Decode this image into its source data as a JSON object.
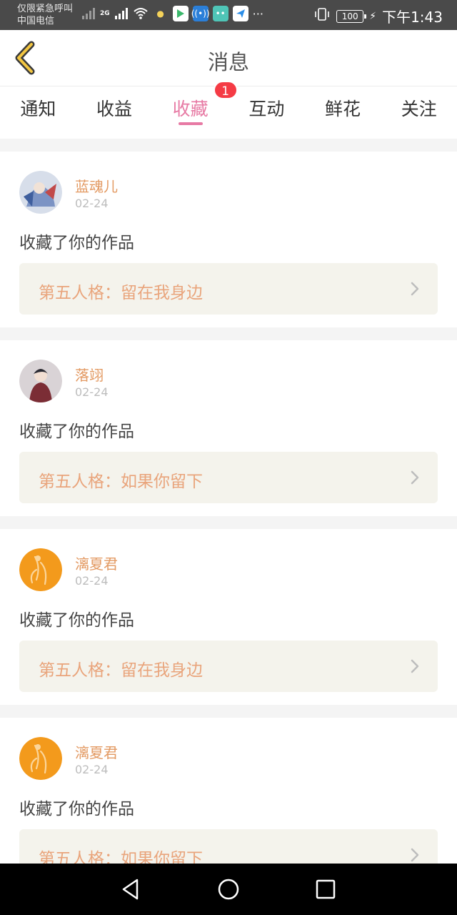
{
  "status_bar": {
    "left_line1": "仅限紧急呼叫",
    "left_line2": "中国电信",
    "network": "2G",
    "battery": "100",
    "time": "下午1:43",
    "more": "···"
  },
  "header": {
    "title": "消息"
  },
  "tabs": [
    {
      "label": "通知"
    },
    {
      "label": "收益"
    },
    {
      "label": "收藏",
      "badge": "1",
      "active": true
    },
    {
      "label": "互动"
    },
    {
      "label": "鲜花"
    },
    {
      "label": "关注"
    }
  ],
  "items": [
    {
      "user": "蓝魂儿",
      "date": "02-24",
      "action": "收藏了你的作品",
      "work": "第五人格：留在我身边",
      "avatar_color": "#9fb4d6"
    },
    {
      "user": "落翊",
      "date": "02-24",
      "action": "收藏了你的作品",
      "work": "第五人格：如果你留下",
      "avatar_color": "#8a7f86"
    },
    {
      "user": "漓夏君",
      "date": "02-24",
      "action": "收藏了你的作品",
      "work": "第五人格：留在我身边",
      "avatar_color": "#f39a1c"
    },
    {
      "user": "漓夏君",
      "date": "02-24",
      "action": "收藏了你的作品",
      "work": "第五人格：如果你留下",
      "avatar_color": "#f39a1c"
    }
  ],
  "colors": {
    "accent": "#e77aa4",
    "username": "#e39a63",
    "work_title": "#e9a47b",
    "badge": "#f53b45"
  }
}
